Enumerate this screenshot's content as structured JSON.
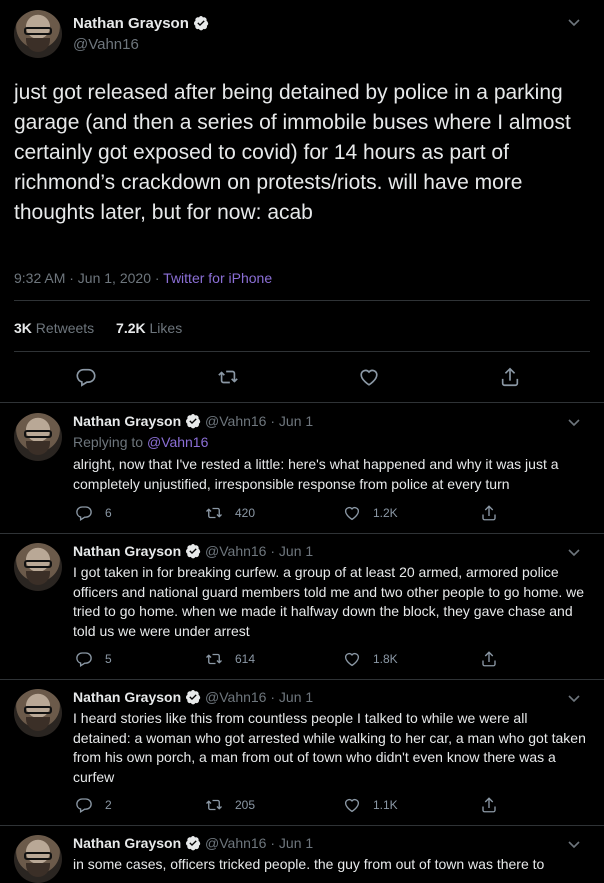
{
  "tweet": {
    "name": "Nathan Grayson",
    "handle": "@Vahn16",
    "text": "just got released after being detained by police in a parking garage (and then a series of immobile buses where I almost certainly got exposed to covid) for 14 hours as part of richmond’s crackdown on protests/riots. will have more thoughts later, but for now: acab",
    "time": "9:32 AM · Jun 1, 2020 ·",
    "source": "Twitter for iPhone",
    "retweets_count": "3K",
    "retweets_label": "Retweets",
    "likes_count": "7.2K",
    "likes_label": "Likes"
  },
  "replies": [
    {
      "name": "Nathan Grayson",
      "meta": "@Vahn16 · Jun 1",
      "replying_prefix": "Replying to",
      "replying_handle": "@Vahn16",
      "text": "alright, now that I've rested a little: here's what happened and why it was just a completely unjustified, irresponsible response from police at every turn",
      "replies": "6",
      "retweets": "420",
      "likes": "1.2K"
    },
    {
      "name": "Nathan Grayson",
      "meta": "@Vahn16 · Jun 1",
      "text": "I got taken in for breaking curfew. a group of at least 20 armed, armored police officers and national guard members told me and two other people to go home. we tried to go home. when we made it halfway down the block, they gave chase and told us we were under arrest",
      "replies": "5",
      "retweets": "614",
      "likes": "1.8K"
    },
    {
      "name": "Nathan Grayson",
      "meta": "@Vahn16 · Jun 1",
      "text": "I heard stories like this from countless people I talked to while we were all detained: a woman who got arrested while walking to her car, a man who got taken from his own porch, a man from out of town who didn't even know there was a curfew",
      "replies": "2",
      "retweets": "205",
      "likes": "1.1K"
    },
    {
      "name": "Nathan Grayson",
      "meta": "@Vahn16 · Jun 1",
      "text": "in some cases, officers tricked people. the guy from out of town was there to"
    }
  ],
  "colors": {
    "background": "#000000",
    "accent": "#8b6fd6",
    "muted": "#6e767d",
    "verified": "#ffffff"
  }
}
